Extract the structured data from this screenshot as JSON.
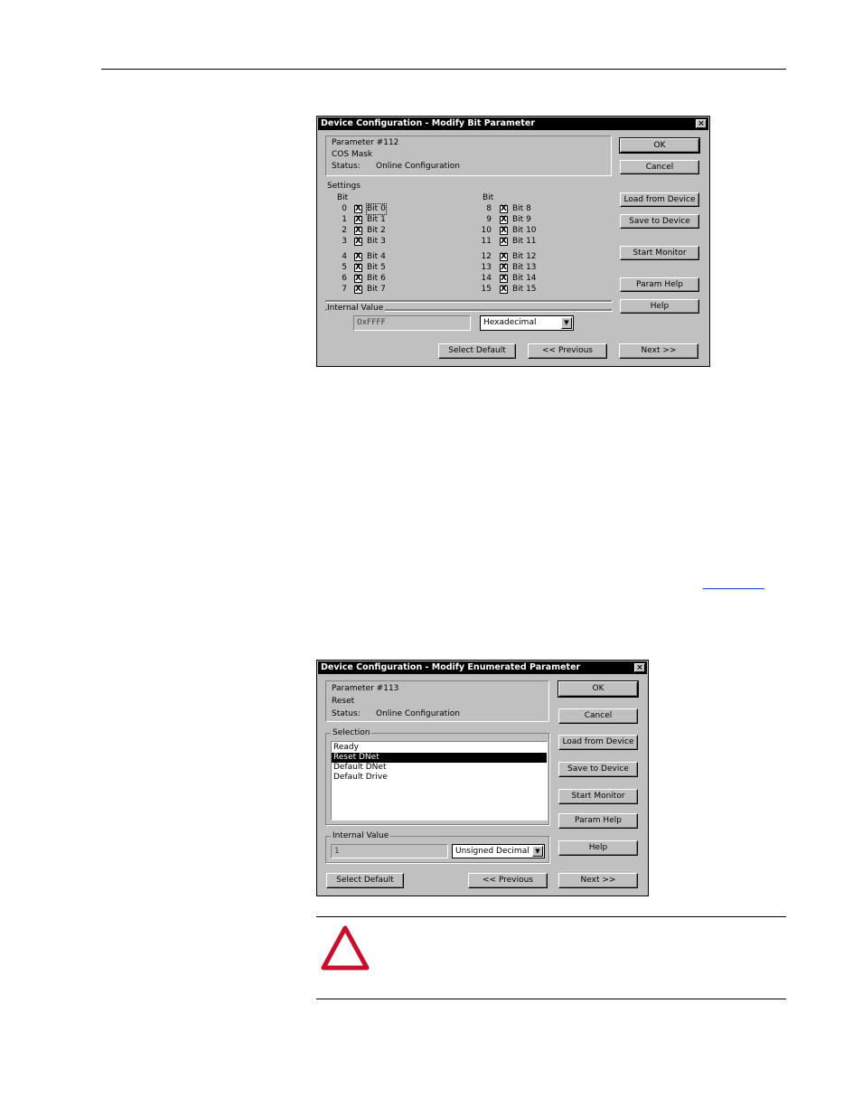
{
  "dialog1": {
    "title": "Device Configuration - Modify Bit Parameter",
    "close_glyph": "×",
    "param_number": "Parameter #112",
    "param_name": "COS Mask",
    "status_label": "Status:",
    "status_value": "Online Configuration",
    "settings_label": "Settings",
    "bit_header_left": "Bit",
    "bit_header_right": "Bit",
    "left_bits": [
      {
        "num": "0",
        "label": "Bit 0"
      },
      {
        "num": "1",
        "label": "Bit 1"
      },
      {
        "num": "2",
        "label": "Bit 2"
      },
      {
        "num": "3",
        "label": "Bit 3"
      },
      {
        "num": "4",
        "label": "Bit 4"
      },
      {
        "num": "5",
        "label": "Bit 5"
      },
      {
        "num": "6",
        "label": "Bit 6"
      },
      {
        "num": "7",
        "label": "Bit 7"
      }
    ],
    "right_bits": [
      {
        "num": "8",
        "label": "Bit 8"
      },
      {
        "num": "9",
        "label": "Bit 9"
      },
      {
        "num": "10",
        "label": "Bit 10"
      },
      {
        "num": "11",
        "label": "Bit 11"
      },
      {
        "num": "12",
        "label": "Bit 12"
      },
      {
        "num": "13",
        "label": "Bit 13"
      },
      {
        "num": "14",
        "label": "Bit 14"
      },
      {
        "num": "15",
        "label": "Bit 15"
      }
    ],
    "check_glyph": "X",
    "internal_value_label": "Internal Value",
    "internal_value": "0xFFFF",
    "format_value": "Hexadecimal",
    "buttons": {
      "ok": "OK",
      "cancel": "Cancel",
      "load": "Load from Device",
      "save": "Save to Device",
      "monitor": "Start Monitor",
      "param_help": "Param Help",
      "help": "Help",
      "select_default": "Select Default",
      "previous": "<< Previous",
      "next": "Next >>"
    }
  },
  "dialog2": {
    "title": "Device Configuration - Modify Enumerated Parameter",
    "close_glyph": "×",
    "param_number": "Parameter #113",
    "param_name": "Reset",
    "status_label": "Status:",
    "status_value": "Online Configuration",
    "selection_label": "Selection",
    "options": [
      "Ready",
      "Reset DNet",
      "Default DNet",
      "Default Drive"
    ],
    "selected_index": 1,
    "internal_value_label": "Internal Value",
    "internal_value": "1",
    "format_value": "Unsigned Decimal",
    "buttons": {
      "ok": "OK",
      "cancel": "Cancel",
      "load": "Load from Device",
      "save": "Save to Device",
      "monitor": "Start Monitor",
      "param_help": "Param Help",
      "help": "Help",
      "select_default": "Select Default",
      "previous": "<< Previous",
      "next": "Next >>"
    }
  },
  "colors": {
    "warning_red": "#c8102e",
    "link_blue": "#1a3fc8",
    "dialog_gray": "#c0c0c0"
  },
  "icons": {
    "warning": "warning-triangle-icon"
  }
}
